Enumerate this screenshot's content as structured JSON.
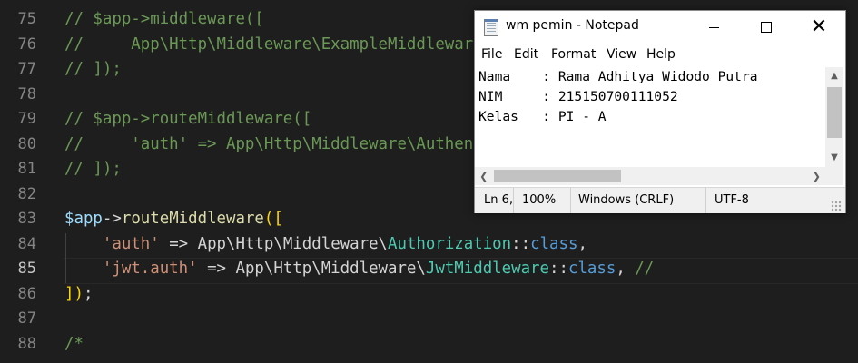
{
  "editor": {
    "lines": [
      {
        "num": "75",
        "tokens": [
          [
            "comment",
            "// $app->middleware(["
          ]
        ]
      },
      {
        "num": "76",
        "tokens": [
          [
            "comment",
            "//     App\\Http\\Middleware\\ExampleMiddleware::class"
          ]
        ]
      },
      {
        "num": "77",
        "tokens": [
          [
            "comment",
            "// ]);"
          ]
        ]
      },
      {
        "num": "78",
        "tokens": []
      },
      {
        "num": "79",
        "tokens": [
          [
            "comment",
            "// $app->routeMiddleware(["
          ]
        ]
      },
      {
        "num": "80",
        "tokens": [
          [
            "comment",
            "//     'auth' => App\\Http\\Middleware\\Authenticate::class,"
          ]
        ]
      },
      {
        "num": "81",
        "tokens": [
          [
            "comment",
            "// ]);"
          ]
        ]
      },
      {
        "num": "82",
        "tokens": []
      },
      {
        "num": "83",
        "tokens": [
          [
            "var",
            "$app"
          ],
          [
            "op",
            "->"
          ],
          [
            "fn",
            "routeMiddleware"
          ],
          [
            "brk",
            "(["
          ]
        ]
      },
      {
        "num": "84",
        "tokens": [
          [
            "plain",
            "    "
          ],
          [
            "str",
            "'auth'"
          ],
          [
            "op",
            " => "
          ],
          [
            "ns",
            "App\\Http\\Middleware\\"
          ],
          [
            "cls",
            "Authorization"
          ],
          [
            "op",
            "::"
          ],
          [
            "kw",
            "class"
          ],
          [
            "plain",
            ","
          ]
        ]
      },
      {
        "num": "85",
        "tokens": [
          [
            "plain",
            "    "
          ],
          [
            "str",
            "'jwt.auth'"
          ],
          [
            "op",
            " => "
          ],
          [
            "ns",
            "App\\Http\\Middleware\\"
          ],
          [
            "cls",
            "JwtMiddleware"
          ],
          [
            "op",
            "::"
          ],
          [
            "kw",
            "class"
          ],
          [
            "plain",
            ", "
          ],
          [
            "comment",
            "//"
          ]
        ],
        "active": true
      },
      {
        "num": "86",
        "tokens": [
          [
            "brk",
            "])"
          ],
          [
            "plain",
            ";"
          ]
        ]
      },
      {
        "num": "87",
        "tokens": []
      },
      {
        "num": "88",
        "tokens": [
          [
            "comment",
            "/*"
          ]
        ]
      }
    ]
  },
  "notepad": {
    "title": "wm pemin - Notepad",
    "controls": {
      "minimize": "—",
      "maximize": "☐",
      "close": "✕"
    },
    "menu": [
      "File",
      "Edit",
      "Format",
      "View",
      "Help"
    ],
    "content": [
      "Nama    : Rama Adhitya Widodo Putra",
      "NIM     : 215150700111052",
      "Kelas   : PI - A"
    ],
    "status": {
      "position": "Ln 6,",
      "zoom": "100%",
      "line_ending": "Windows (CRLF)",
      "encoding": "UTF-8"
    }
  }
}
